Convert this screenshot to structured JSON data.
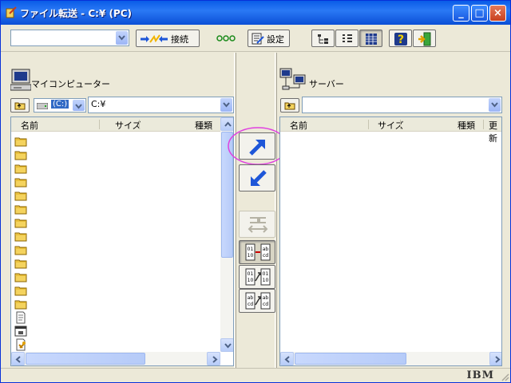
{
  "window": {
    "title": "ファイル転送 - C:¥ (PC)",
    "minimize_symbol": "_",
    "maximize_symbol": "□",
    "close_symbol": "×"
  },
  "toolbar": {
    "connection_combo_value": "",
    "connect_label": "接続",
    "status_dots": "ooo",
    "settings_label": "設定",
    "view_buttons": [
      "tree-view-icon",
      "list-view-icon",
      "details-view-icon"
    ],
    "help_icon": "help-question-icon",
    "exit_icon": "exit-door-icon"
  },
  "left_pane": {
    "title": "マイコンピューター",
    "drive_label": "(C:)",
    "path_value": "C:¥",
    "columns": [
      "名前",
      "サイズ",
      "種類"
    ],
    "rows": [
      {
        "icon": "folder-icon"
      },
      {
        "icon": "folder-icon"
      },
      {
        "icon": "folder-icon"
      },
      {
        "icon": "folder-icon"
      },
      {
        "icon": "folder-icon"
      },
      {
        "icon": "folder-icon"
      },
      {
        "icon": "folder-icon"
      },
      {
        "icon": "folder-icon"
      },
      {
        "icon": "folder-icon"
      },
      {
        "icon": "folder-icon"
      },
      {
        "icon": "folder-icon"
      },
      {
        "icon": "folder-icon"
      },
      {
        "icon": "folder-icon"
      },
      {
        "icon": "text-file-icon"
      },
      {
        "icon": "system-file-icon"
      },
      {
        "icon": "script-file-icon"
      }
    ]
  },
  "right_pane": {
    "title": "サーバー",
    "path_value": "",
    "columns": [
      "名前",
      "サイズ",
      "種類",
      "更新"
    ],
    "rows": []
  },
  "transfer": {
    "upload_icon": "upload-arrow-icon",
    "download_icon": "download-arrow-icon",
    "sync_icon": "sync-icon",
    "mode_buttons": [
      "binary-transfer-icon",
      "text-transfer-icon",
      "auto-transfer-icon"
    ]
  },
  "statusbar": {
    "brand": "IBM"
  },
  "colors": {
    "title_bar": "#0a5ce7",
    "highlight_circle": "#e040e0",
    "arrow_blue": "#1e56d8"
  }
}
